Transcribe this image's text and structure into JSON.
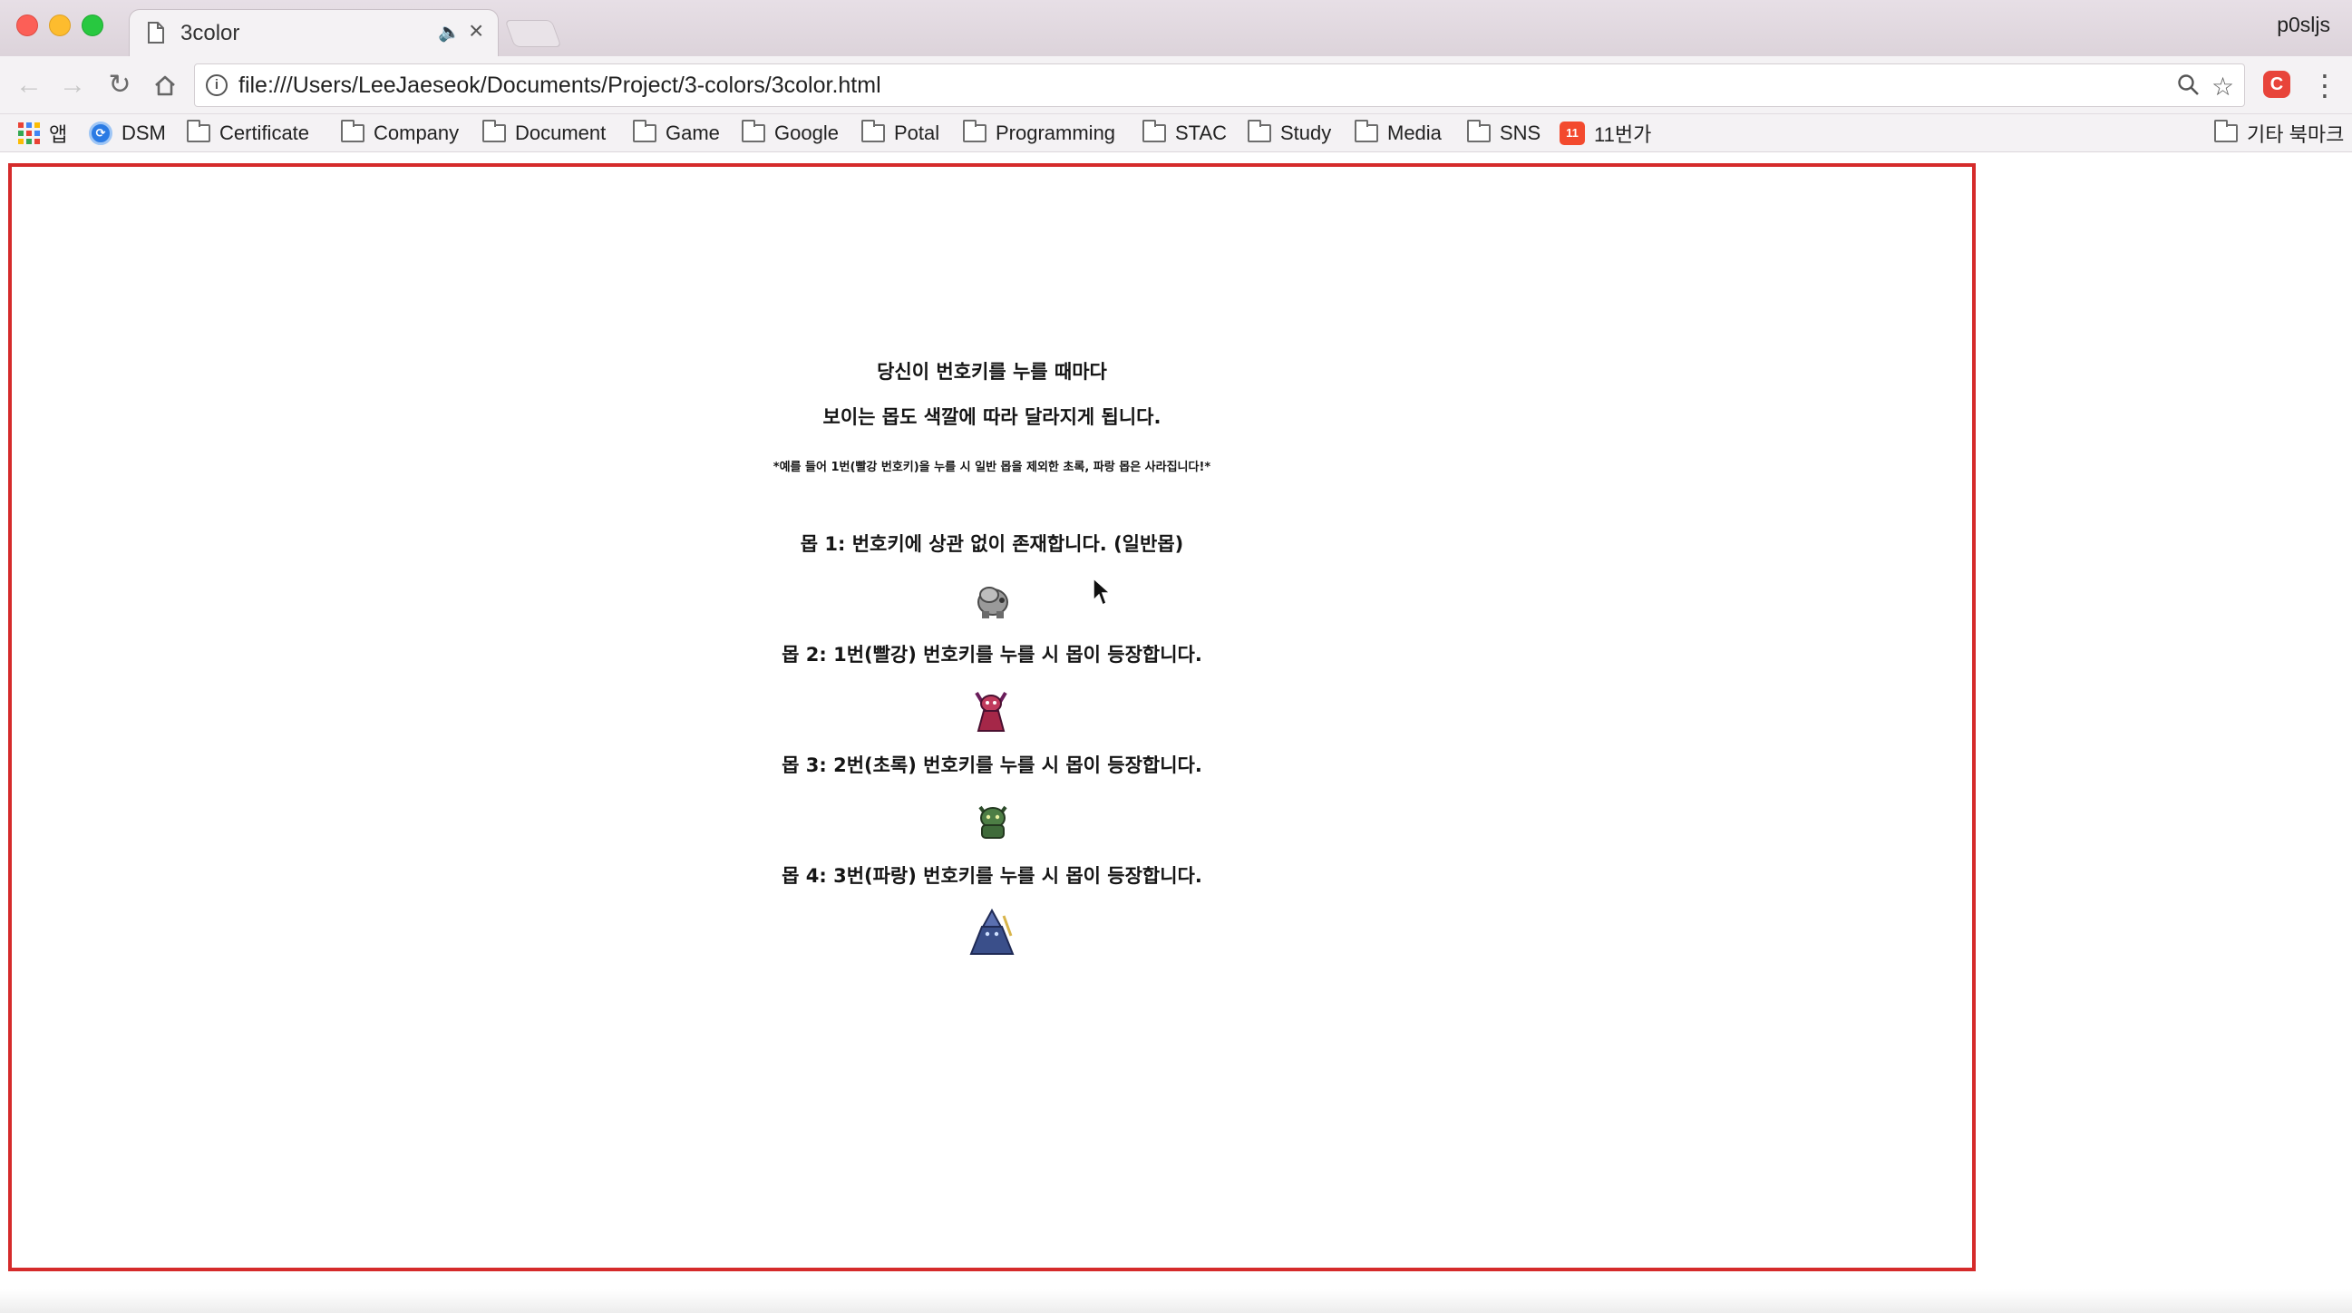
{
  "tab": {
    "title": "3color",
    "audio_icon": "speaker-icon",
    "close_glyph": "×"
  },
  "profile": {
    "name": "p0sljs"
  },
  "toolbar": {
    "url": "file:///Users/LeeJaeseok/Documents/Project/3-colors/3color.html"
  },
  "bookmarks": {
    "apps_label": "앱",
    "items": [
      {
        "label": "DSM",
        "icon": "dsm-icon"
      },
      {
        "label": "Certificate",
        "icon": "folder-icon"
      },
      {
        "label": "Company",
        "icon": "folder-icon"
      },
      {
        "label": "Document",
        "icon": "folder-icon"
      },
      {
        "label": "Game",
        "icon": "folder-icon"
      },
      {
        "label": "Google",
        "icon": "folder-icon"
      },
      {
        "label": "Potal",
        "icon": "folder-icon"
      },
      {
        "label": "Programming",
        "icon": "folder-icon"
      },
      {
        "label": "STAC",
        "icon": "folder-icon"
      },
      {
        "label": "Study",
        "icon": "folder-icon"
      },
      {
        "label": "Media",
        "icon": "folder-icon"
      },
      {
        "label": "SNS",
        "icon": "folder-icon"
      },
      {
        "label": "11번가",
        "icon": "eleven-street-icon"
      }
    ],
    "other_label": "기타 북마크"
  },
  "page": {
    "intro_line1": "당신이 번호키를 누를 때마다",
    "intro_line2": "보이는 몹도 색깔에 따라 달라지게 됩니다.",
    "note": "*예를 들어 1번(빨강 번호키)을 누를 시 일반 몹을 제외한 초록, 파랑 몹은 사라집니다!*",
    "mobs": [
      {
        "description": "몹 1: 번호키에 상관 없이 존재합니다. (일반몹)",
        "color": "#8a8a8a",
        "sprite": "gray-mob-sprite"
      },
      {
        "description": "몹 2: 1번(빨강) 번호키를 누를 시 몹이 등장합니다.",
        "color": "#b0284a",
        "sprite": "red-mob-sprite"
      },
      {
        "description": "몹 3: 2번(초록) 번호키를 누를 시 몹이 등장합니다.",
        "color": "#3f6b3a",
        "sprite": "green-mob-sprite"
      },
      {
        "description": "몹 4: 3번(파랑) 번호키를 누를 시 몹이 등장합니다.",
        "color": "#3a4f8a",
        "sprite": "blue-mob-sprite"
      }
    ]
  },
  "colors": {
    "frame_border": "#d52b2b",
    "accent_red": "#fc5f57"
  }
}
